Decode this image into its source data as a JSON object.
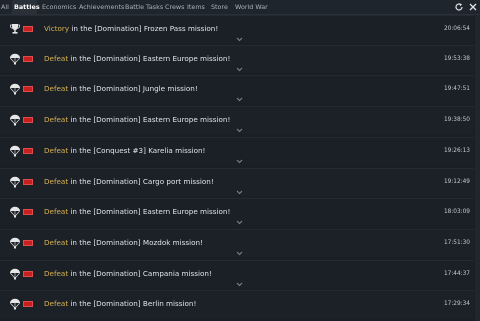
{
  "tabs": [
    {
      "label": "All",
      "active": false
    },
    {
      "label": "Battles",
      "active": true
    },
    {
      "label": "Economics",
      "active": false
    },
    {
      "label": "Achievements",
      "active": false
    },
    {
      "label": "Battle Tasks",
      "active": false
    },
    {
      "label": "Crews",
      "active": false
    },
    {
      "label": "Items",
      "active": false
    },
    {
      "label": "Store",
      "active": false
    },
    {
      "label": "World War",
      "active": false
    }
  ],
  "toolbar": {
    "refresh_icon": "refresh-icon",
    "close_icon": "close-icon"
  },
  "colors": {
    "victory": "#d8b250",
    "defeat": "#d8b250",
    "flag": "#c62020",
    "background": "#1a1f25"
  },
  "entries": [
    {
      "icon": "victory-trophy-icon",
      "outcome": "Victory",
      "text": " in the [Domination] Frozen Pass mission!",
      "time": "20:06:54"
    },
    {
      "icon": "defeat-parachute-icon",
      "outcome": "Defeat",
      "text": " in the [Domination] Eastern Europe mission!",
      "time": "19:53:38"
    },
    {
      "icon": "defeat-parachute-icon",
      "outcome": "Defeat",
      "text": " in the [Domination] Jungle mission!",
      "time": "19:47:51"
    },
    {
      "icon": "defeat-parachute-icon",
      "outcome": "Defeat",
      "text": " in the [Domination] Eastern Europe mission!",
      "time": "19:38:50"
    },
    {
      "icon": "defeat-parachute-icon",
      "outcome": "Defeat",
      "text": " in the [Conquest #3] Karelia mission!",
      "time": "19:26:13"
    },
    {
      "icon": "defeat-parachute-icon",
      "outcome": "Defeat",
      "text": " in the [Domination] Cargo port mission!",
      "time": "19:12:49"
    },
    {
      "icon": "defeat-parachute-icon",
      "outcome": "Defeat",
      "text": " in the [Domination] Eastern Europe mission!",
      "time": "18:03:09"
    },
    {
      "icon": "defeat-parachute-icon",
      "outcome": "Defeat",
      "text": " in the [Domination] Mozdok mission!",
      "time": "17:51:30"
    },
    {
      "icon": "defeat-parachute-icon",
      "outcome": "Defeat",
      "text": " in the [Domination] Campania mission!",
      "time": "17:44:37"
    },
    {
      "icon": "defeat-parachute-icon",
      "outcome": "Defeat",
      "text": " in the [Domination] Berlin mission!",
      "time": "17:29:34"
    }
  ]
}
